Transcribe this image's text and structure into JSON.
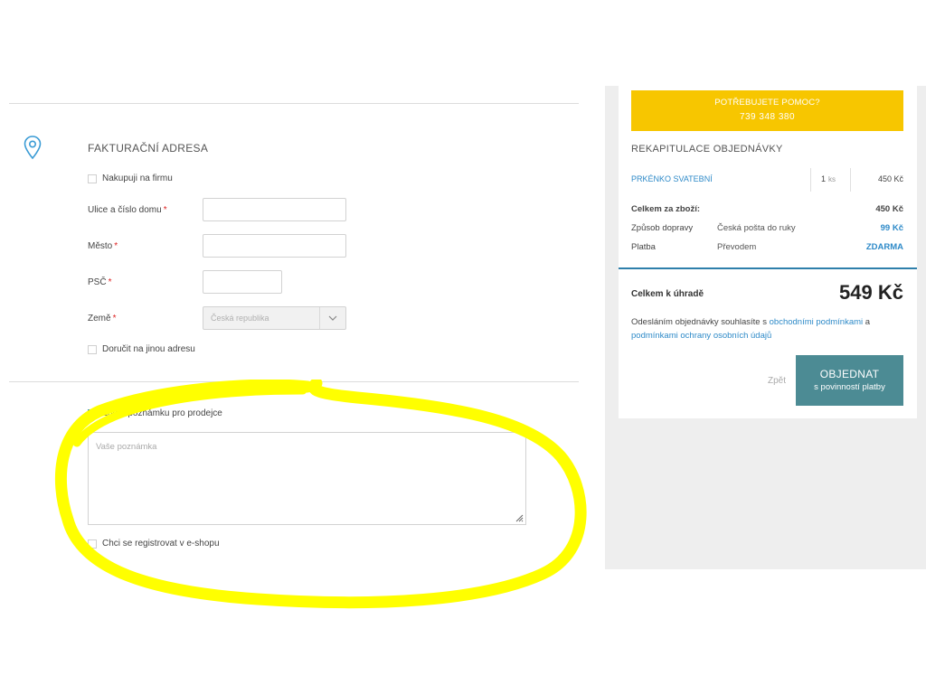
{
  "billing": {
    "title": "FAKTURAČNÍ ADRESA",
    "company_checkbox": "Nakupuji na firmu",
    "street_label": "Ulice a číslo domu",
    "city_label": "Město",
    "zip_label": "PSČ",
    "country_label": "Země",
    "required_mark": "*",
    "country_value": "Česká republika",
    "other_address_checkbox": "Doručit na jinou adresu"
  },
  "note": {
    "checkbox_label": "Zadat poznámku pro prodejce",
    "checked": true,
    "placeholder": "Vaše poznámka",
    "register_checkbox": "Chci se registrovat v e-shopu"
  },
  "help": {
    "title": "POTŘEBUJETE POMOC?",
    "phone": "739 348 380"
  },
  "recap": {
    "title": "REKAPITULACE OBJEDNÁVKY",
    "item_name": "PRKÉNKO SVATEBNÍ",
    "item_qty": "1",
    "item_unit": "ks",
    "item_price": "450 Kč",
    "goods_total_label": "Celkem za zboží:",
    "goods_total_value": "450 Kč",
    "shipping_label": "Způsob dopravy",
    "shipping_method": "Česká pošta do ruky",
    "shipping_price": "99 Kč",
    "payment_label": "Platba",
    "payment_method": "Převodem",
    "payment_price": "ZDARMA",
    "grand_total_label": "Celkem k úhradě",
    "grand_total_value": "549 Kč",
    "terms_1": "Odesláním objednávky souhlasíte s ",
    "terms_link_1": "obchodními podmínkami",
    "terms_2": " a ",
    "terms_link_2": "podmínkami ochrany osobních údajů",
    "back": "Zpět",
    "order_line1": "OBJEDNAT",
    "order_line2": "s povinností platby"
  },
  "colors": {
    "accent_blue": "#2e8ac8",
    "help_yellow": "#f7c600",
    "order_button": "#4c8b94",
    "highlight": "#ffff00"
  }
}
